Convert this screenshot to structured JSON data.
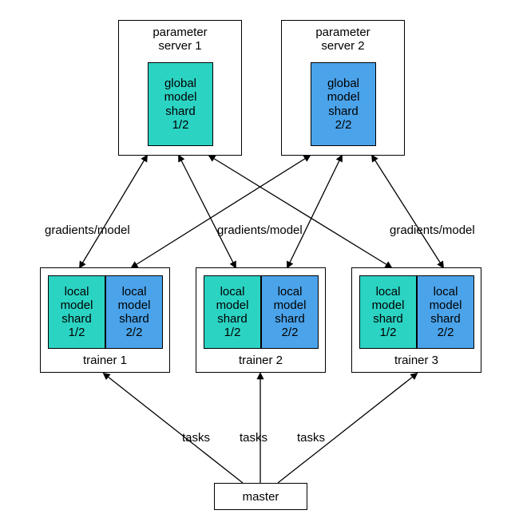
{
  "ps1": {
    "title": "parameter\nserver 1",
    "shard": "global\nmodel\nshard\n1/2"
  },
  "ps2": {
    "title": "parameter\nserver 2",
    "shard": "global\nmodel\nshard\n2/2"
  },
  "trainer1": {
    "title": "trainer 1",
    "shard1": "local\nmodel\nshard\n1/2",
    "shard2": "local\nmodel\nshard\n2/2"
  },
  "trainer2": {
    "title": "trainer 2",
    "shard1": "local\nmodel\nshard\n1/2",
    "shard2": "local\nmodel\nshard\n2/2"
  },
  "trainer3": {
    "title": "trainer 3",
    "shard1": "local\nmodel\nshard\n1/2",
    "shard2": "local\nmodel\nshard\n2/2"
  },
  "master": "master",
  "edge_grad": "gradients/model",
  "edge_tasks": "tasks",
  "colors": {
    "teal": "#2bd3c3",
    "blue": "#4ba3ea"
  }
}
